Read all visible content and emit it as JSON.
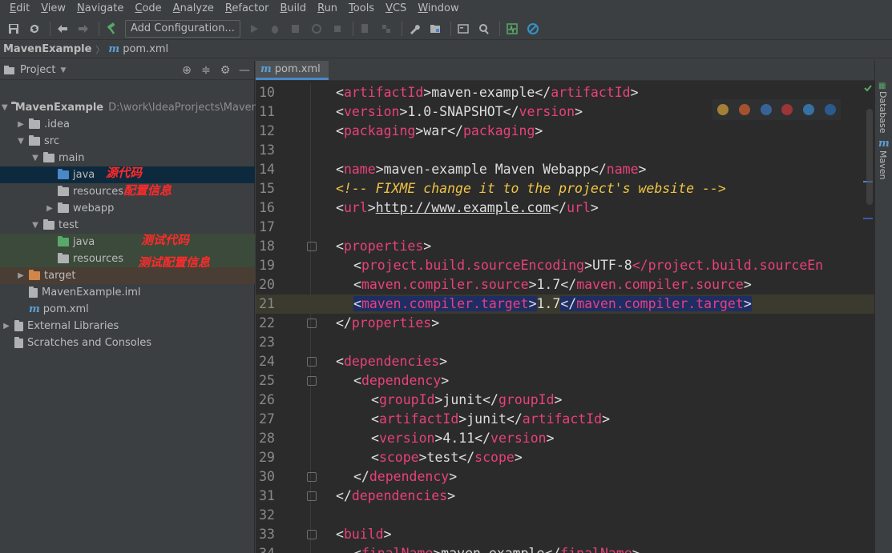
{
  "menu": [
    "Edit",
    "View",
    "Navigate",
    "Code",
    "Analyze",
    "Refactor",
    "Build",
    "Run",
    "Tools",
    "VCS",
    "Window"
  ],
  "toolbar": {
    "add_configuration": "Add Configuration..."
  },
  "navbar": {
    "project": "MavenExample",
    "file": "pom.xml",
    "file_icon": "m"
  },
  "project_panel": {
    "title": "Project",
    "tree": [
      {
        "label": "MavenExample",
        "path": "D:\\work\\IdeaProrjects\\MavenEx",
        "depth": 0,
        "expanded": true,
        "bold": true,
        "icon": "module-folder"
      },
      {
        "label": ".idea",
        "depth": 1,
        "expanded": false,
        "icon": "folder"
      },
      {
        "label": "src",
        "depth": 1,
        "expanded": true,
        "icon": "folder"
      },
      {
        "label": "main",
        "depth": 2,
        "expanded": true,
        "icon": "folder"
      },
      {
        "label": "java",
        "depth": 3,
        "icon": "source-folder",
        "annotation": "源代码"
      },
      {
        "label": "resources",
        "depth": 3,
        "icon": "resources-folder",
        "annotation": "配置信息"
      },
      {
        "label": "webapp",
        "depth": 3,
        "expanded": false,
        "icon": "web-folder"
      },
      {
        "label": "test",
        "depth": 2,
        "expanded": true,
        "icon": "folder"
      },
      {
        "label": "java",
        "depth": 3,
        "icon": "test-source-folder",
        "annotation": "测试代码"
      },
      {
        "label": "resources",
        "depth": 3,
        "icon": "test-resources-folder",
        "annotation": "测试配置信息"
      },
      {
        "label": "target",
        "depth": 1,
        "expanded": false,
        "icon": "excluded-folder"
      },
      {
        "label": "MavenExample.iml",
        "depth": 1,
        "icon": "iml-file"
      },
      {
        "label": "pom.xml",
        "depth": 1,
        "icon": "maven-file"
      },
      {
        "label": "External Libraries",
        "depth": 0,
        "expanded": false,
        "icon": "libraries"
      },
      {
        "label": "Scratches and Consoles",
        "depth": 0,
        "icon": "scratches"
      }
    ]
  },
  "editor": {
    "tab": "pom.xml",
    "current_line": 21,
    "lines": [
      {
        "n": "10",
        "indent": 0,
        "html": "artifactId",
        "text": "maven-example"
      },
      {
        "n": "11",
        "indent": 0,
        "html": "version",
        "text": "1.0-SNAPSHOT"
      },
      {
        "n": "12",
        "indent": 0,
        "html": "packaging",
        "text": "war"
      },
      {
        "n": "13"
      },
      {
        "n": "14",
        "indent": 0,
        "html": "name",
        "text": "maven-example Maven Webapp"
      },
      {
        "n": "15",
        "indent": 0,
        "comment": "<!-- FIXME change it to the project's website -->"
      },
      {
        "n": "16",
        "indent": 0,
        "html": "url",
        "text": "http://www.example.com",
        "link": true
      },
      {
        "n": "17"
      },
      {
        "n": "18",
        "indent": 0,
        "open": "properties",
        "fold": true
      },
      {
        "n": "19",
        "indent": 1,
        "html": "project.build.sourceEncoding",
        "text": "UTF-8",
        "truncated": "</project.build.sourceEn"
      },
      {
        "n": "20",
        "indent": 1,
        "html": "maven.compiler.source",
        "text": "1.7"
      },
      {
        "n": "21",
        "indent": 1,
        "html": "maven.compiler.target",
        "text": "1.7",
        "selected": true
      },
      {
        "n": "22",
        "indent": 0,
        "close": "properties",
        "fold": true
      },
      {
        "n": "23"
      },
      {
        "n": "24",
        "indent": 0,
        "open": "dependencies",
        "fold": true
      },
      {
        "n": "25",
        "indent": 1,
        "open": "dependency",
        "fold": true
      },
      {
        "n": "26",
        "indent": 2,
        "html": "groupId",
        "text": "junit"
      },
      {
        "n": "27",
        "indent": 2,
        "html": "artifactId",
        "text": "junit"
      },
      {
        "n": "28",
        "indent": 2,
        "html": "version",
        "text": "4.11"
      },
      {
        "n": "29",
        "indent": 2,
        "html": "scope",
        "text": "test"
      },
      {
        "n": "30",
        "indent": 1,
        "close": "dependency",
        "fold": true
      },
      {
        "n": "31",
        "indent": 0,
        "close": "dependencies",
        "fold": true
      },
      {
        "n": "32"
      },
      {
        "n": "33",
        "indent": 0,
        "open": "build",
        "fold": true
      },
      {
        "n": "34",
        "indent": 1,
        "html": "finalName",
        "text": "maven-example"
      }
    ]
  },
  "right_stripe": {
    "database": "Database",
    "maven": "Maven"
  },
  "colors": {
    "tag": "#e8417a",
    "comment": "#f0c443",
    "annotation": "#ff2a2a",
    "accent": "#4a88c7"
  }
}
